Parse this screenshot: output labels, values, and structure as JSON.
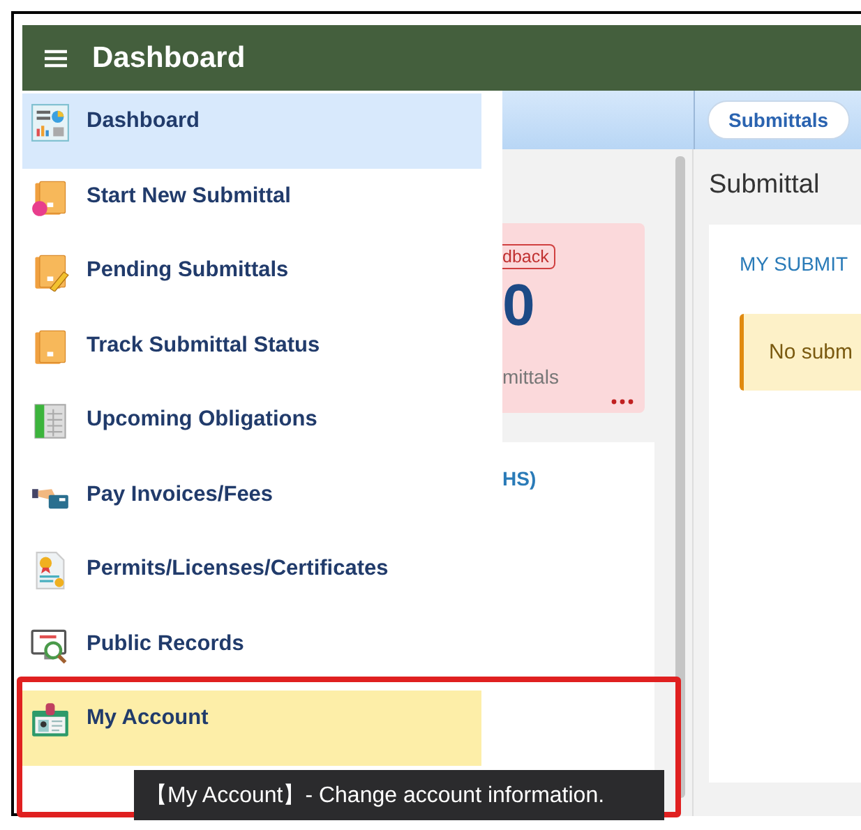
{
  "header": {
    "title": "Dashboard"
  },
  "sidebar": {
    "items": [
      {
        "kind": "dashboard",
        "label": "Dashboard",
        "selected": true,
        "hovered": false
      },
      {
        "kind": "new-submittal",
        "label": "Start New Submittal",
        "selected": false,
        "hovered": false
      },
      {
        "kind": "pending",
        "label": "Pending Submittals",
        "selected": false,
        "hovered": false
      },
      {
        "kind": "track",
        "label": "Track Submittal Status",
        "selected": false,
        "hovered": false
      },
      {
        "kind": "obligations",
        "label": "Upcoming Obligations",
        "selected": false,
        "hovered": false
      },
      {
        "kind": "pay",
        "label": "Pay Invoices/Fees",
        "selected": false,
        "hovered": false
      },
      {
        "kind": "permits",
        "label": "Permits/Licenses/Certificates",
        "selected": false,
        "hovered": false
      },
      {
        "kind": "records",
        "label": "Public Records",
        "selected": false,
        "hovered": false
      },
      {
        "kind": "account",
        "label": "My Account",
        "selected": false,
        "hovered": true
      }
    ]
  },
  "top_bar": {
    "tab": "Submittals"
  },
  "left_panel": {
    "badge": "dback",
    "count": "0",
    "caption": "mittals",
    "card_title": "HS)"
  },
  "right_panel": {
    "title": "Submittal",
    "card_title": "MY SUBMIT",
    "alert": "No subm"
  },
  "tooltip": {
    "text": "【My Account】- Change account information."
  }
}
